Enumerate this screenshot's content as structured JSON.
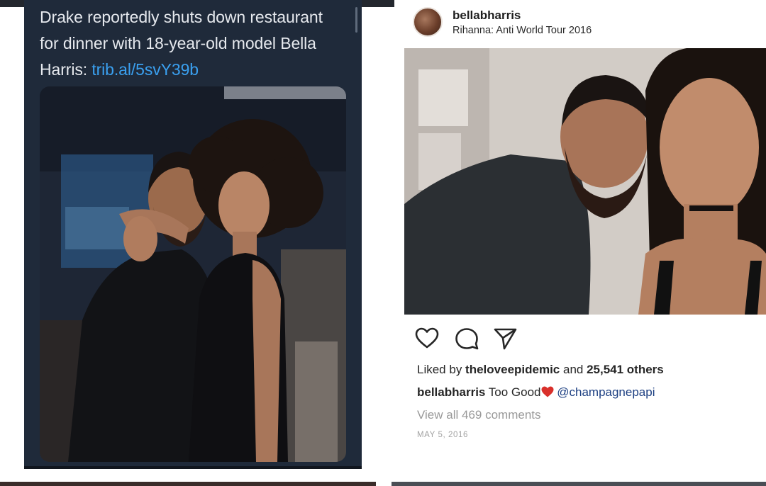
{
  "tweet": {
    "text_line1": "Drake reportedly shuts down restaurant",
    "text_line2": "for dinner with 18-year-old model Bella",
    "text_line3_prefix": "Harris: ",
    "link": "trib.al/5svY39b",
    "link_color": "#3aa0f0",
    "background": "#1f2a3a"
  },
  "instagram": {
    "username": "bellabharris",
    "location": "Rihanna: Anti World Tour 2016",
    "actions": {
      "like_icon": "heart-outline-icon",
      "comment_icon": "comment-bubble-icon",
      "share_icon": "paper-plane-icon"
    },
    "likes": {
      "prefix": "Liked by ",
      "liker": "theloveepidemic",
      "middle": " and ",
      "count": "25,541 others"
    },
    "caption": {
      "user": "bellabharris",
      "text": " Too Good",
      "emoji": "red-heart",
      "mention": " @champagnepapi"
    },
    "comments_link": "View all 469 comments",
    "date": "MAY 5, 2016",
    "mention_color": "#1c3f82"
  }
}
